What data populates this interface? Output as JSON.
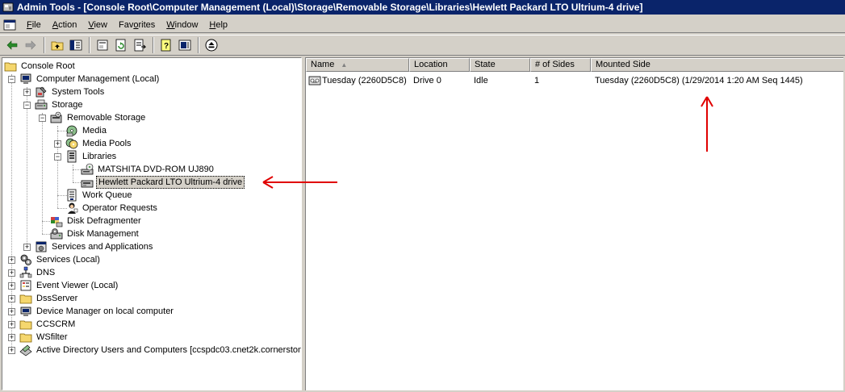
{
  "window": {
    "title": "Admin Tools - [Console Root\\Computer Management (Local)\\Storage\\Removable Storage\\Libraries\\Hewlett Packard LTO Ultrium-4 drive]"
  },
  "menu": {
    "file": {
      "u": "F",
      "rest": "ile"
    },
    "action": {
      "u": "A",
      "rest": "ction"
    },
    "view": {
      "u": "V",
      "rest": "iew"
    },
    "favorites": {
      "pre": "Fav",
      "u": "o",
      "rest": "rites"
    },
    "window": {
      "u": "W",
      "rest": "indow"
    },
    "help": {
      "u": "H",
      "rest": "elp"
    }
  },
  "tree": {
    "console_root": "Console Root",
    "computer_management": "Computer Management (Local)",
    "system_tools": "System Tools",
    "storage": "Storage",
    "removable_storage": "Removable Storage",
    "media": "Media",
    "media_pools": "Media Pools",
    "libraries": "Libraries",
    "matshita": "MATSHITA DVD-ROM UJ890",
    "hp_lto": "Hewlett Packard LTO Ultrium-4 drive",
    "work_queue": "Work Queue",
    "operator_requests": "Operator Requests",
    "disk_defragmenter": "Disk Defragmenter",
    "disk_management": "Disk Management",
    "services_apps": "Services and Applications",
    "services_local": "Services (Local)",
    "dns": "DNS",
    "event_viewer": "Event Viewer (Local)",
    "dssserver": "DssServer",
    "device_manager": "Device Manager on local computer",
    "ccscrm": "CCSCRM",
    "wsfilter": "WSfilter",
    "ad_users": "Active Directory Users and Computers [ccspdc03.cnet2k.cornerston"
  },
  "list": {
    "columns": [
      "Name",
      "Location",
      "State",
      "# of Sides",
      "Mounted Side"
    ],
    "rows": [
      [
        "Tuesday (2260D5C8)",
        "Drive 0",
        "Idle",
        "1",
        "Tuesday (2260D5C8) (1/29/2014 1:20 AM Seq 1445)"
      ]
    ]
  },
  "colors": {
    "titlebar": "#0a246a",
    "annotation_arrow": "#e00000"
  }
}
